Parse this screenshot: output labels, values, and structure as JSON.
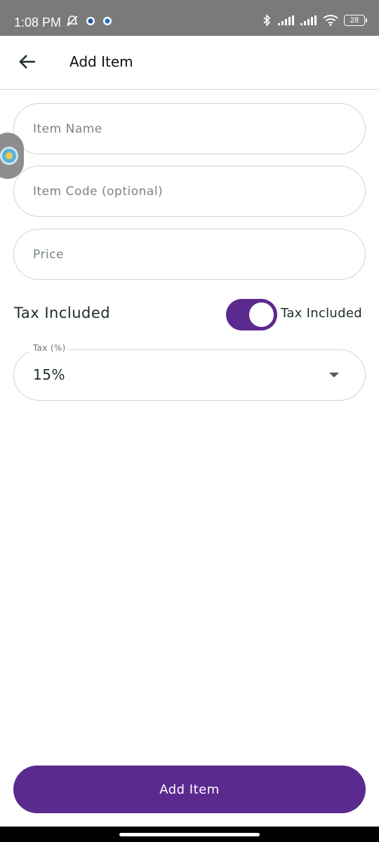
{
  "status_bar": {
    "time": "1:08 PM",
    "battery_level": "28",
    "left_icons": [
      "bell-off-icon",
      "app-notification-icon",
      "app-notification-icon"
    ],
    "right_icons": [
      "bluetooth-icon",
      "signal-icon",
      "signal-icon",
      "wifi-icon",
      "battery-icon"
    ]
  },
  "app_bar": {
    "title": "Add Item",
    "back_icon": "arrow-left-icon"
  },
  "form": {
    "item_name": {
      "placeholder": "Item Name",
      "value": ""
    },
    "item_code": {
      "placeholder": "Item Code (optional)",
      "value": ""
    },
    "price": {
      "placeholder": "Price",
      "value": ""
    },
    "tax_included": {
      "row_label": "Tax Included",
      "switch_label": "Tax Included",
      "on": true
    },
    "tax": {
      "label": "Tax (%)",
      "value": "15%"
    }
  },
  "actions": {
    "submit_label": "Add Item"
  },
  "colors": {
    "accent": "#5b2a8f",
    "border": "#cfd4d4",
    "status_bar": "#7a7a7a"
  }
}
